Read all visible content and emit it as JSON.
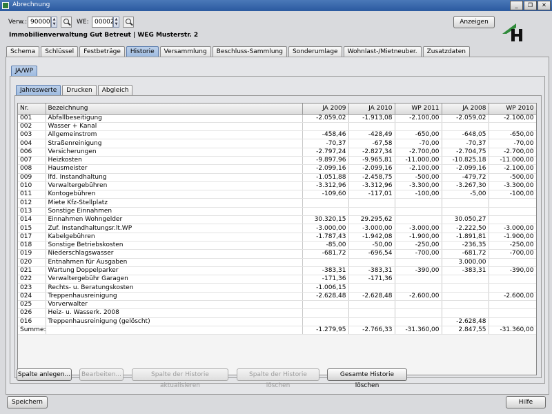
{
  "window": {
    "title": "Abrechnung"
  },
  "header": {
    "verw_label": "Verw.:",
    "verw_value": "90000",
    "we_label": "WE:",
    "we_value": "00002",
    "show_button": "Anzeigen",
    "subtitle": "Immobilienverwaltung Gut Betreut | WEG Musterstr. 2"
  },
  "main_tabs": [
    "Schema",
    "Schlüssel",
    "Festbeträge",
    "Historie",
    "Versammlung",
    "Beschluss-Sammlung",
    "Sonderumlage",
    "Wohnlast-/Mietneuber.",
    "Zusatzdaten"
  ],
  "sub_tab": "JA/WP",
  "inner_tabs": [
    "Jahreswerte",
    "Drucken",
    "Abgleich"
  ],
  "table": {
    "headers": [
      "Nr.",
      "Bezeichnung",
      "JA 2009",
      "JA 2010",
      "WP 2011",
      "JA 2008",
      "WP 2010"
    ],
    "rows": [
      [
        "001",
        "Abfallbeseitigung",
        "-2.059,02",
        "-1.913,08",
        "-2.100,00",
        "-2.059,02",
        "-2.100,00"
      ],
      [
        "002",
        "Wasser + Kanal",
        "",
        "",
        "",
        "",
        ""
      ],
      [
        "003",
        "Allgemeinstrom",
        "-458,46",
        "-428,49",
        "-650,00",
        "-648,05",
        "-650,00"
      ],
      [
        "004",
        "Straßenreinigung",
        "-70,37",
        "-67,58",
        "-70,00",
        "-70,37",
        "-70,00"
      ],
      [
        "006",
        "Versicherungen",
        "-2.797,24",
        "-2.827,34",
        "-2.700,00",
        "-2.704,75",
        "-2.700,00"
      ],
      [
        "007",
        "Heizkosten",
        "-9.897,96",
        "-9.965,81",
        "-11.000,00",
        "-10.825,18",
        "-11.000,00"
      ],
      [
        "008",
        "Hausmeister",
        "-2.099,16",
        "-2.099,16",
        "-2.100,00",
        "-2.099,16",
        "-2.100,00"
      ],
      [
        "009",
        "lfd. Instandhaltung",
        "-1.051,88",
        "-2.458,75",
        "-500,00",
        "-479,72",
        "-500,00"
      ],
      [
        "010",
        "Verwaltergebühren",
        "-3.312,96",
        "-3.312,96",
        "-3.300,00",
        "-3.267,30",
        "-3.300,00"
      ],
      [
        "011",
        "Kontogebühren",
        "-109,60",
        "-117,01",
        "-100,00",
        "-5,00",
        "-100,00"
      ],
      [
        "012",
        "Miete Kfz-Stellplatz",
        "",
        "",
        "",
        "",
        ""
      ],
      [
        "013",
        "Sonstige Einnahmen",
        "",
        "",
        "",
        "",
        ""
      ],
      [
        "014",
        "Einnahmen Wohngelder",
        "30.320,15",
        "29.295,62",
        "",
        "30.050,27",
        ""
      ],
      [
        "015",
        "Zuf. Instandhaltungsr.lt.WP",
        "-3.000,00",
        "-3.000,00",
        "-3.000,00",
        "-2.222,50",
        "-3.000,00"
      ],
      [
        "017",
        "Kabelgebühren",
        "-1.787,43",
        "-1.942,08",
        "-1.900,00",
        "-1.891,81",
        "-1.900,00"
      ],
      [
        "018",
        "Sonstige Betriebskosten",
        "-85,00",
        "-50,00",
        "-250,00",
        "-236,35",
        "-250,00"
      ],
      [
        "019",
        "Niederschlagswasser",
        "-681,72",
        "-696,54",
        "-700,00",
        "-681,72",
        "-700,00"
      ],
      [
        "020",
        "Entnahmen für Ausgaben",
        "",
        "",
        "",
        "3.000,00",
        ""
      ],
      [
        "021",
        "Wartung Doppelparker",
        "-383,31",
        "-383,31",
        "-390,00",
        "-383,31",
        "-390,00"
      ],
      [
        "022",
        "Verwaltergebühr Garagen",
        "-171,36",
        "-171,36",
        "",
        "",
        ""
      ],
      [
        "023",
        "Rechts- u. Beratungskosten",
        "-1.006,15",
        "",
        "",
        "",
        ""
      ],
      [
        "024",
        "Treppenhausreinigung",
        "-2.628,48",
        "-2.628,48",
        "-2.600,00",
        "",
        "-2.600,00"
      ],
      [
        "025",
        "Vorverwalter",
        "",
        "",
        "",
        "",
        ""
      ],
      [
        "026",
        "Heiz- u. Wasserk. 2008",
        "",
        "",
        "",
        "",
        ""
      ],
      [
        "016",
        "Treppenhausreinigung (gelöscht)",
        "",
        "",
        "",
        "-2.628,48",
        ""
      ]
    ],
    "sum_row": [
      "Summe:",
      "",
      "-1.279,95",
      "-2.766,33",
      "-31.360,00",
      "2.847,55",
      "-31.360,00"
    ]
  },
  "actions": {
    "add_column": "Spalte anlegen...",
    "edit": "Bearbeiten...",
    "update_history_column": "Spalte der Historie aktualisieren",
    "delete_history_column": "Spalte der Historie löschen",
    "delete_all_history": "Gesamte Historie löschen"
  },
  "footer": {
    "save": "Speichern",
    "help": "Hilfe"
  },
  "window_buttons": {
    "minimize": "_",
    "restore": "❐",
    "close": "✕"
  },
  "colors": {
    "accent": "#2b5aa0",
    "tab_active": "#a9c3e4"
  }
}
